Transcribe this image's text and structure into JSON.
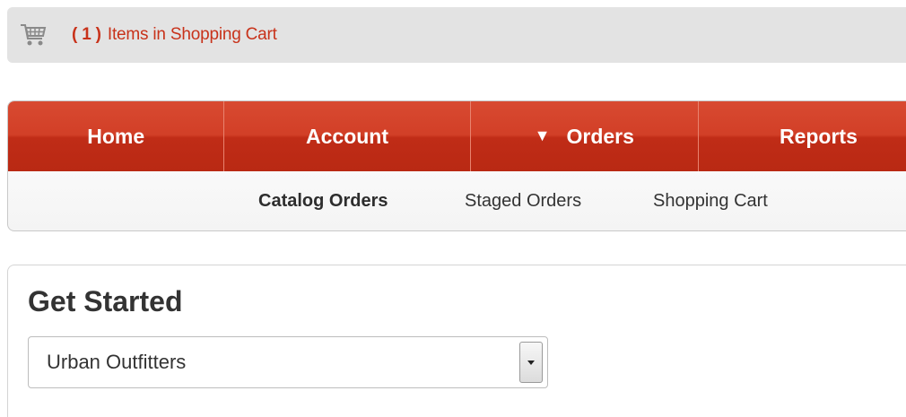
{
  "cart": {
    "icon": "shopping-cart-icon",
    "count": "( 1 )",
    "label": "Items in Shopping Cart"
  },
  "nav": {
    "items": [
      {
        "label": "Home"
      },
      {
        "label": "Account"
      },
      {
        "label": "Orders",
        "indicator": "▼"
      },
      {
        "label": "Reports"
      }
    ]
  },
  "subnav": {
    "items": [
      {
        "label": "Catalog Orders",
        "active": true
      },
      {
        "label": "Staged Orders"
      },
      {
        "label": "Shopping Cart"
      }
    ]
  },
  "panel": {
    "title": "Get Started",
    "select_value": "Urban Outfitters"
  },
  "colors": {
    "accent": "#c8321a",
    "nav_bg": "#c8321a"
  }
}
